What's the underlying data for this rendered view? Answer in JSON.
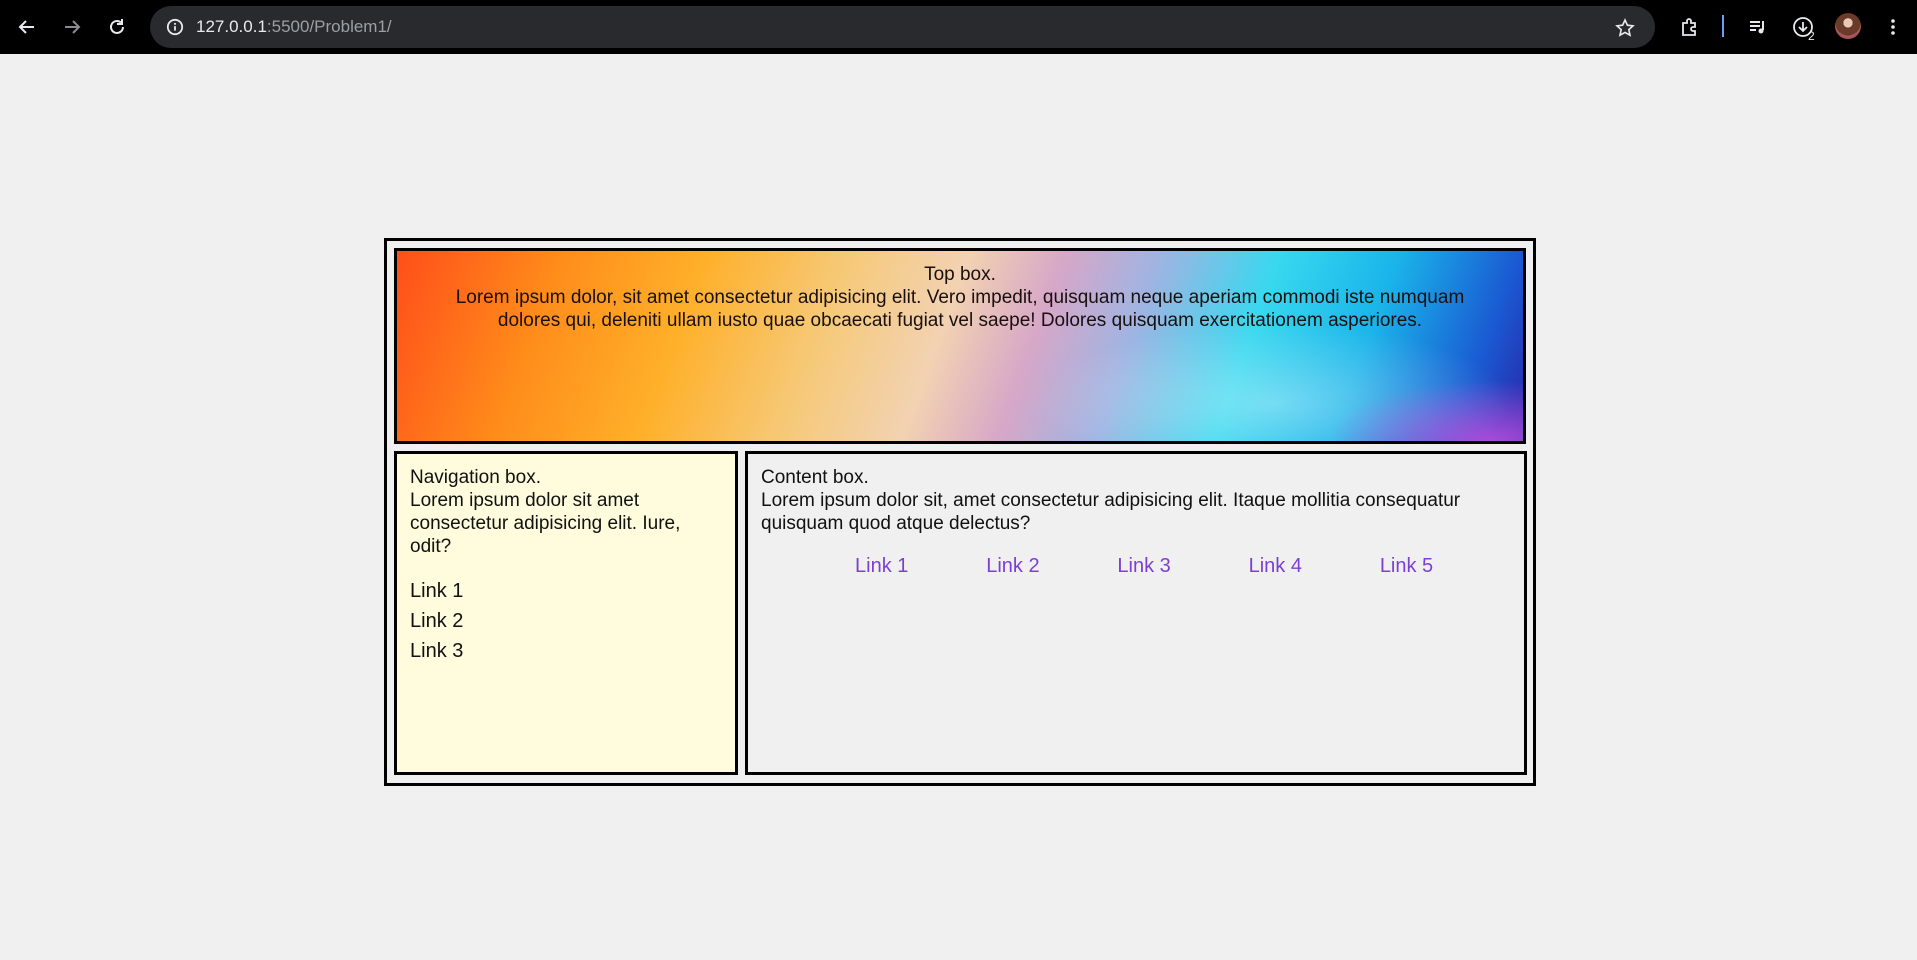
{
  "browser": {
    "url_host": "127.0.0.1",
    "url_rest": ":5500/Problem1/",
    "download_count": "2"
  },
  "top_box": {
    "title": "Top box.",
    "text": "Lorem ipsum dolor, sit amet consectetur adipisicing elit. Vero impedit, quisquam neque aperiam commodi iste numquam dolores qui, deleniti ullam iusto quae obcaecati fugiat vel saepe! Dolores quisquam exercitationem asperiores."
  },
  "nav_box": {
    "title": "Navigation box.",
    "text": "Lorem ipsum dolor sit amet consectetur adipisicing elit. Iure, odit?",
    "links": [
      "Link 1",
      "Link 2",
      "Link 3"
    ]
  },
  "content_box": {
    "title": "Content box.",
    "text": "Lorem ipsum dolor sit, amet consectetur adipisicing elit. Itaque mollitia consequatur quisquam quod atque delectus?",
    "links": [
      "Link 1",
      "Link 2",
      "Link 3",
      "Link 4",
      "Link 5"
    ]
  },
  "colors": {
    "page_background": "#f0f0f0",
    "nav_background": "#fefcdc",
    "content_link": "#7b3fd6"
  }
}
